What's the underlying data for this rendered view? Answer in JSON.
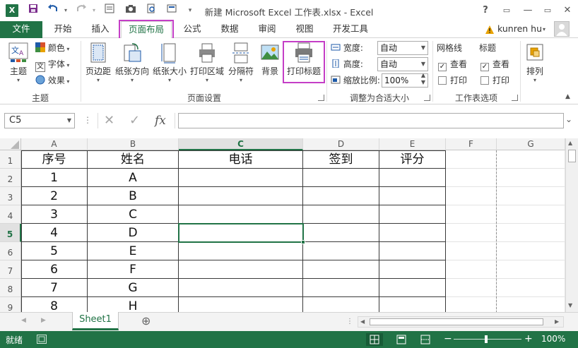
{
  "window": {
    "title": "新建 Microsoft Excel 工作表.xlsx - Excel",
    "controls": [
      "?",
      "▭",
      "—",
      "▭",
      "✕"
    ]
  },
  "tabs": {
    "file": "文件",
    "items": [
      "开始",
      "插入",
      "页面布局",
      "公式",
      "数据",
      "审阅",
      "视图",
      "开发工具"
    ],
    "active": "页面布局",
    "user": "kunren hu"
  },
  "ribbon": {
    "theme_group": {
      "label": "主题",
      "theme_btn": "主题",
      "colors": "颜色",
      "fonts": "字体",
      "effects": "效果"
    },
    "page_setup": {
      "label": "页面设置",
      "buttons": [
        "页边距",
        "纸张方向",
        "纸张大小",
        "打印区域",
        "分隔符",
        "背景",
        "打印标题"
      ]
    },
    "scale": {
      "label": "调整为合适大小",
      "width_label": "宽度:",
      "width_value": "自动",
      "height_label": "高度:",
      "height_value": "自动",
      "scale_label": "缩放比例:",
      "scale_value": "100%"
    },
    "sheet_options": {
      "label": "工作表选项",
      "gridlines": "网格线",
      "headings": "标题",
      "view": "查看",
      "print": "打印"
    },
    "arrange": {
      "label": "排列"
    }
  },
  "formula_bar": {
    "name_box": "C5",
    "fx": "fx",
    "content": ""
  },
  "sheet": {
    "columns": [
      "A",
      "B",
      "C",
      "D",
      "E",
      "F",
      "G"
    ],
    "rows": [
      "1",
      "2",
      "3",
      "4",
      "5",
      "6",
      "7",
      "8",
      "9"
    ],
    "selected_cell": "C5",
    "headers": [
      "序号",
      "姓名",
      "电话",
      "签到",
      "评分"
    ],
    "data": [
      [
        "1",
        "A"
      ],
      [
        "2",
        "B"
      ],
      [
        "3",
        "C"
      ],
      [
        "4",
        "D"
      ],
      [
        "5",
        "E"
      ],
      [
        "6",
        "F"
      ],
      [
        "7",
        "G"
      ],
      [
        "8",
        "H"
      ]
    ]
  },
  "sheet_tabs": {
    "active": "Sheet1",
    "add": "⊕"
  },
  "status": {
    "mode": "就绪",
    "zoom": "100%"
  },
  "colors": {
    "accent": "#217346",
    "highlight": "#c43ec6"
  }
}
